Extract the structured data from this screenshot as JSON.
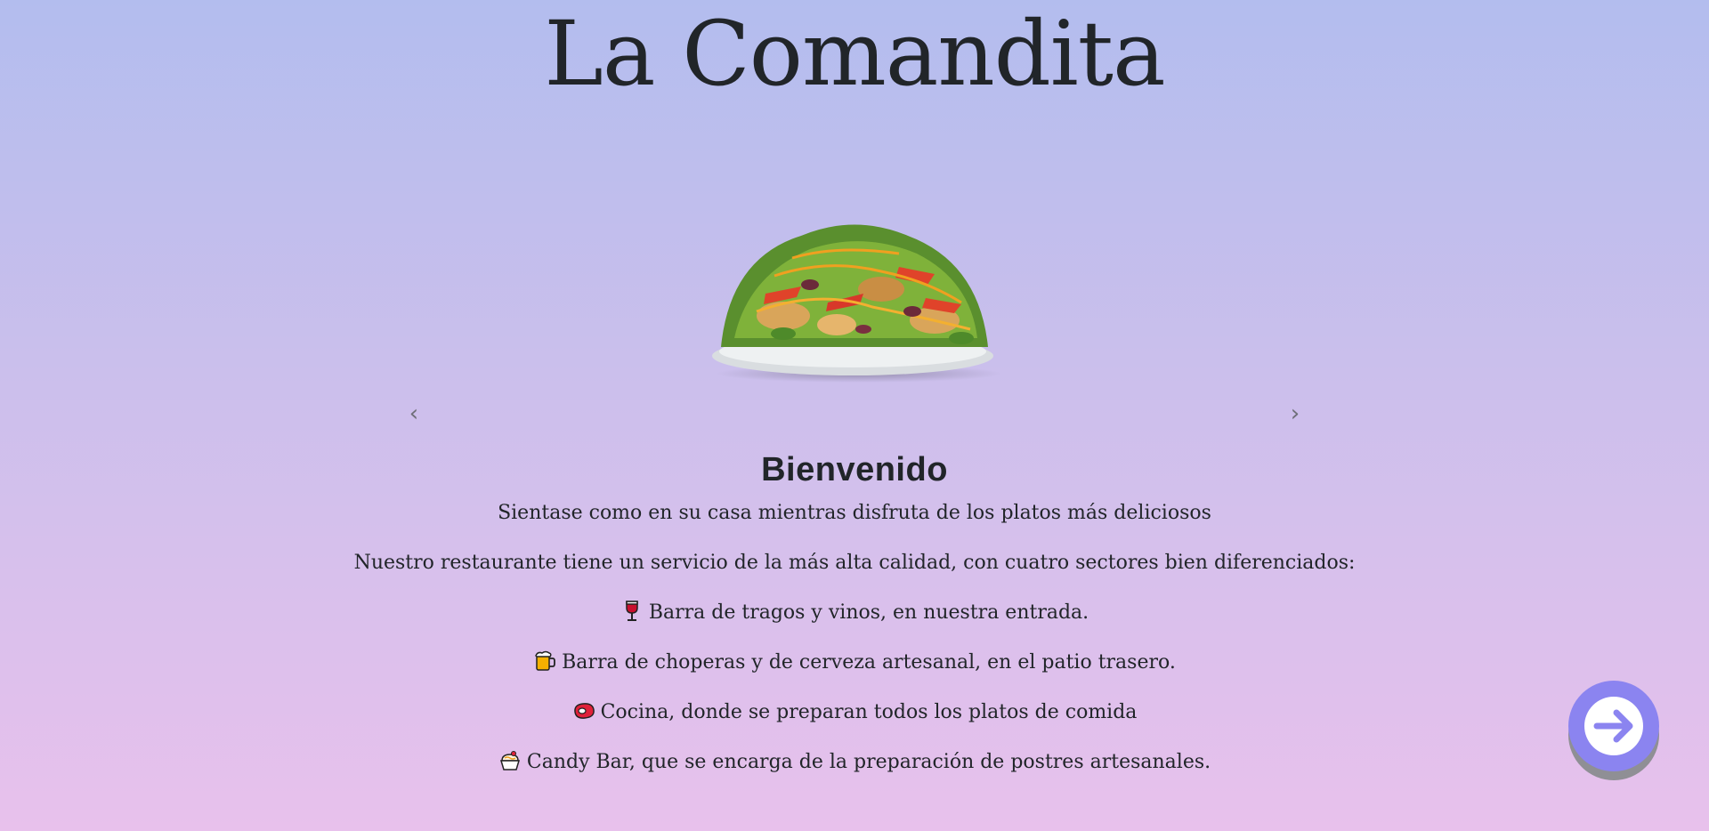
{
  "header": {
    "title": "La Comandita"
  },
  "carousel": {
    "image": "salad-plate",
    "prev_icon": "chevron-left-icon",
    "next_icon": "chevron-right-icon",
    "prev_glyph": "‹",
    "next_glyph": "›"
  },
  "content": {
    "heading": "Bienvenido",
    "subtitle": "Sientase como en su casa mientras disfruta de los platos más deliciosos",
    "intro": "Nuestro restaurante tiene un servicio de la más alta calidad, con cuatro sectores bien diferenciados:",
    "sectors": [
      {
        "icon": "wine-glass-icon",
        "text": "Barra de tragos y vinos, en nuestra entrada."
      },
      {
        "icon": "beer-mug-icon",
        "text": "Barra de choperas y de cerveza artesanal, en el patio trasero."
      },
      {
        "icon": "meat-icon",
        "text": "Cocina, donde se preparan todos los platos de comida"
      },
      {
        "icon": "dessert-icon",
        "text": "Candy Bar, que se encarga de la preparación de postres artesanales."
      }
    ]
  },
  "fab": {
    "icon": "arrow-right-circle-icon",
    "color": "#8b84f0"
  }
}
